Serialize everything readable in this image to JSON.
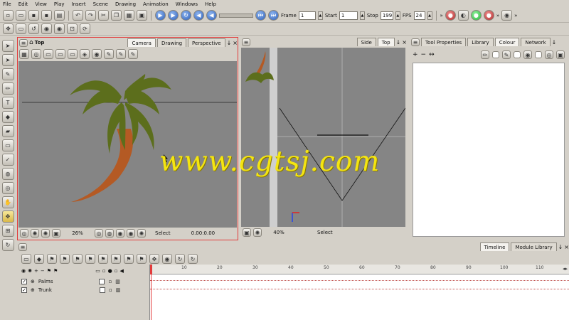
{
  "menu": [
    "File",
    "Edit",
    "View",
    "Play",
    "Insert",
    "Scene",
    "Drawing",
    "Animation",
    "Windows",
    "Help"
  ],
  "playback": {
    "frame_label": "Frame",
    "frame_value": "1",
    "start_label": "Start",
    "start_value": "1",
    "stop_label": "Stop",
    "stop_value": "199",
    "fps_label": "FPS",
    "fps_value": "24"
  },
  "camera_view": {
    "title": "Top",
    "tabs": [
      "Camera",
      "Drawing",
      "Perspective"
    ],
    "zoom": "26%",
    "mode": "Select",
    "timecode": "0.00:0.00"
  },
  "side_view": {
    "tabs": [
      "Side",
      "Top"
    ],
    "zoom": "40%",
    "mode": "Select"
  },
  "right_panel": {
    "tabs": [
      "Tool Properties",
      "Library",
      "Colour",
      "Network"
    ]
  },
  "timeline": {
    "tabs": [
      "Timeline",
      "Module Library"
    ],
    "layers": [
      {
        "name": "Palms",
        "checked": "✓"
      },
      {
        "name": "Trunk",
        "checked": "✓"
      }
    ],
    "ruler": [
      "10",
      "20",
      "30",
      "40",
      "50",
      "60",
      "70",
      "80",
      "90",
      "100",
      "110"
    ]
  },
  "watermark": "www.cgtsj.com",
  "colors": {
    "accent": "#e23b3b",
    "leaf": "#5c6e1c",
    "trunk": "#b45a24",
    "viewport": "#858585",
    "watermark": "#f4e511"
  }
}
